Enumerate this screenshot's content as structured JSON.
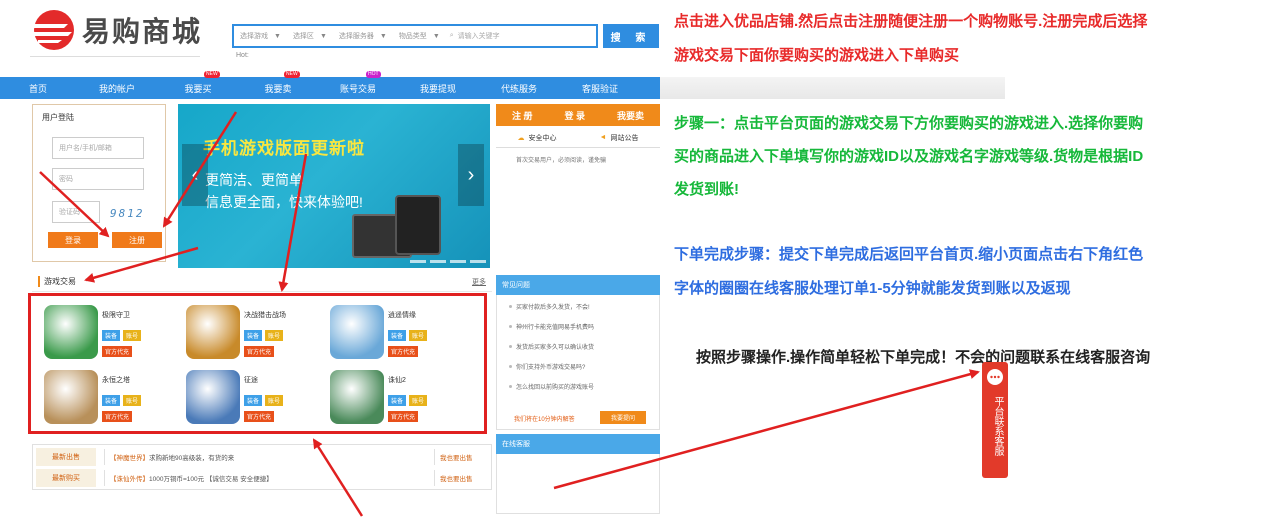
{
  "header": {
    "logo_text": "易购商城",
    "search": {
      "selects": [
        "选择游戏",
        "选择区",
        "选择服务器",
        "物品类型"
      ],
      "placeholder": "请输入关键字",
      "button_label": "搜 索"
    },
    "hot_label": "Hot:"
  },
  "nav": {
    "items": [
      {
        "label": "首页",
        "badge": ""
      },
      {
        "label": "我的帐户",
        "badge": ""
      },
      {
        "label": "我要买",
        "badge": "NEW"
      },
      {
        "label": "我要卖",
        "badge": "NEW"
      },
      {
        "label": "账号交易",
        "badge": "HOT"
      },
      {
        "label": "我要提现",
        "badge": ""
      },
      {
        "label": "代练服务",
        "badge": ""
      },
      {
        "label": "客服验证",
        "badge": ""
      }
    ]
  },
  "login": {
    "title": "用户登陆",
    "username_placeholder": "用户名/手机/邮箱",
    "password_placeholder": "密码",
    "captcha_placeholder": "验证码",
    "captcha_code": "9812",
    "login_button": "登录",
    "register_button": "注册"
  },
  "banner": {
    "title": "手机游戏版面更新啦",
    "lines": [
      "更简洁、更简单",
      "信息更全面，快来体验吧!"
    ]
  },
  "right_panel": {
    "actions": [
      "注 册",
      "登 录",
      "我要卖"
    ],
    "tabs": [
      "安全中心",
      "网站公告"
    ],
    "notice": "首次交易用户，必须阅读，谨免骗",
    "faq_title": "常见问题",
    "faq": [
      "买家付款后多久发货，不会!",
      "神州行卡能充值网易手机费吗",
      "发货后买家多久可以确认收货",
      "你们支持外币游戏交易吗?",
      "怎么找回以前购买的游戏账号"
    ],
    "faq_footer": "我们将在10分钟内解答",
    "faq_button": "我要提问",
    "service_title": "在线客服"
  },
  "games": {
    "title": "游戏交易",
    "more": "更多",
    "tag_labels": [
      "装备",
      "账号",
      "官方代充"
    ],
    "list": [
      {
        "name": "极限守卫",
        "icon": "game-icon-guardian",
        "color": "#3a9a4a"
      },
      {
        "name": "决战猎击战场",
        "icon": "game-icon-warrior",
        "color": "#c88a2a"
      },
      {
        "name": "逍遥情缘",
        "icon": "game-icon-xiaoyao",
        "color": "#6aa8d8"
      },
      {
        "name": "永恒之塔",
        "icon": "game-icon-aion",
        "color": "#b8905a"
      },
      {
        "name": "征途",
        "icon": "game-icon-zhengtu",
        "color": "#4a7ab8"
      },
      {
        "name": "诛仙2",
        "icon": "game-icon-zhuxian",
        "color": "#4a8a5a"
      }
    ]
  },
  "bulletins": [
    {
      "label": "最新出售",
      "tag": "【神魔世界】",
      "text": "求购新地90高级装，有货的来",
      "link": "我也要出售"
    },
    {
      "label": "最新购买",
      "tag": "【诛仙外传】",
      "text": "1000万铜币=100元 【诚信交易 安全便捷】",
      "link": "我也要出售"
    }
  ],
  "instructions": {
    "intro": [
      "点击进入优品店铺.然后点击注册随便注册一个购物账号.注册完成后选择",
      "游戏交易下面你要购买的游戏进入下单购买"
    ],
    "step1": [
      "步骤一：点击平台页面的游戏交易下方你要购买的游戏进入.选择你要购",
      "买的商品进入下单填写你的游戏ID以及游戏名字游戏等级.货物是根据ID",
      "发货到账!"
    ],
    "step2": [
      "下单完成步骤：提交下单完成后返回平台首页.缩小页面点击右下角红色",
      "字体的圈圈在线客服处理订单1-5分钟就能发货到账以及返现"
    ],
    "closing": "按照步骤操作.操作简单轻松下单完成！不会的问题联系在线客服咨询"
  },
  "float_service": {
    "label": "平台联系客服"
  },
  "colors": {
    "brand_blue": "#2f8de0",
    "orange": "#f07a1a",
    "highlight_red": "#e02020",
    "text_red": "#e82a2a",
    "text_green": "#16b83a",
    "text_blue": "#2e6de0"
  }
}
